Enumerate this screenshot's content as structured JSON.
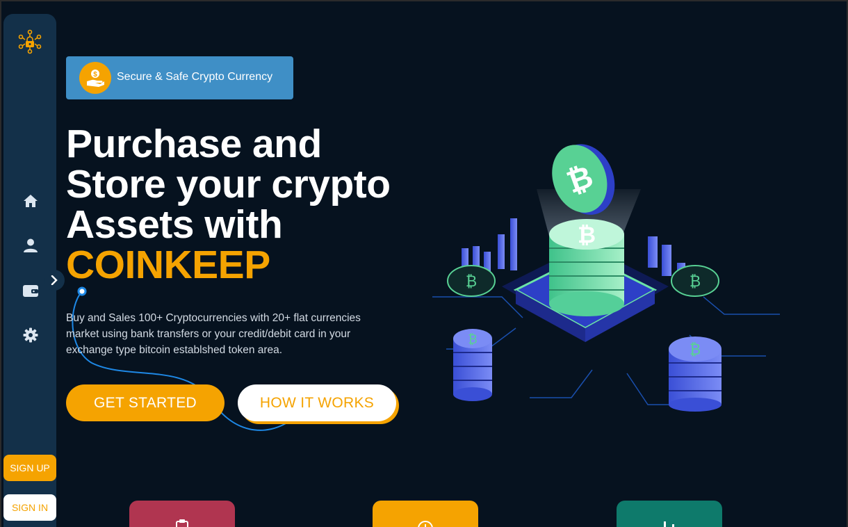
{
  "sidebar": {
    "logo_icon": "blockchain-lock-icon",
    "nav": [
      {
        "icon": "home-icon"
      },
      {
        "icon": "user-icon"
      },
      {
        "icon": "wallet-icon"
      },
      {
        "icon": "gear-icon"
      }
    ],
    "toggle_icon": "chevron-right-icon",
    "signup_label": "SIGN UP",
    "signin_label": "SIGN IN"
  },
  "hero": {
    "badge_icon": "hand-coin-icon",
    "badge_text": "Secure & Safe Crypto Currency",
    "headline_line1": "Purchase and",
    "headline_line2": "Store your crypto",
    "headline_line3": "Assets with",
    "headline_accent": "COINKEEP",
    "description": "Buy and Sales 100+ Cryptocurrencies with 20+ flat currencies market using bank transfers or your credit/debit card in your exchange type bitcoin establshed token area.",
    "get_started_label": "GET STARTED",
    "how_it_works_label": "HOW IT WORKS"
  },
  "feature_cards": [
    {
      "icon": "clipboard-icon",
      "color": "#b03550"
    },
    {
      "icon": "coin-icon",
      "color": "#f5a301"
    },
    {
      "icon": "bar-chart-icon",
      "color": "#0e7a6b"
    }
  ],
  "colors": {
    "background": "#06121f",
    "sidebar": "#133049",
    "accent": "#f5a301",
    "badge": "#3f8fc6"
  }
}
